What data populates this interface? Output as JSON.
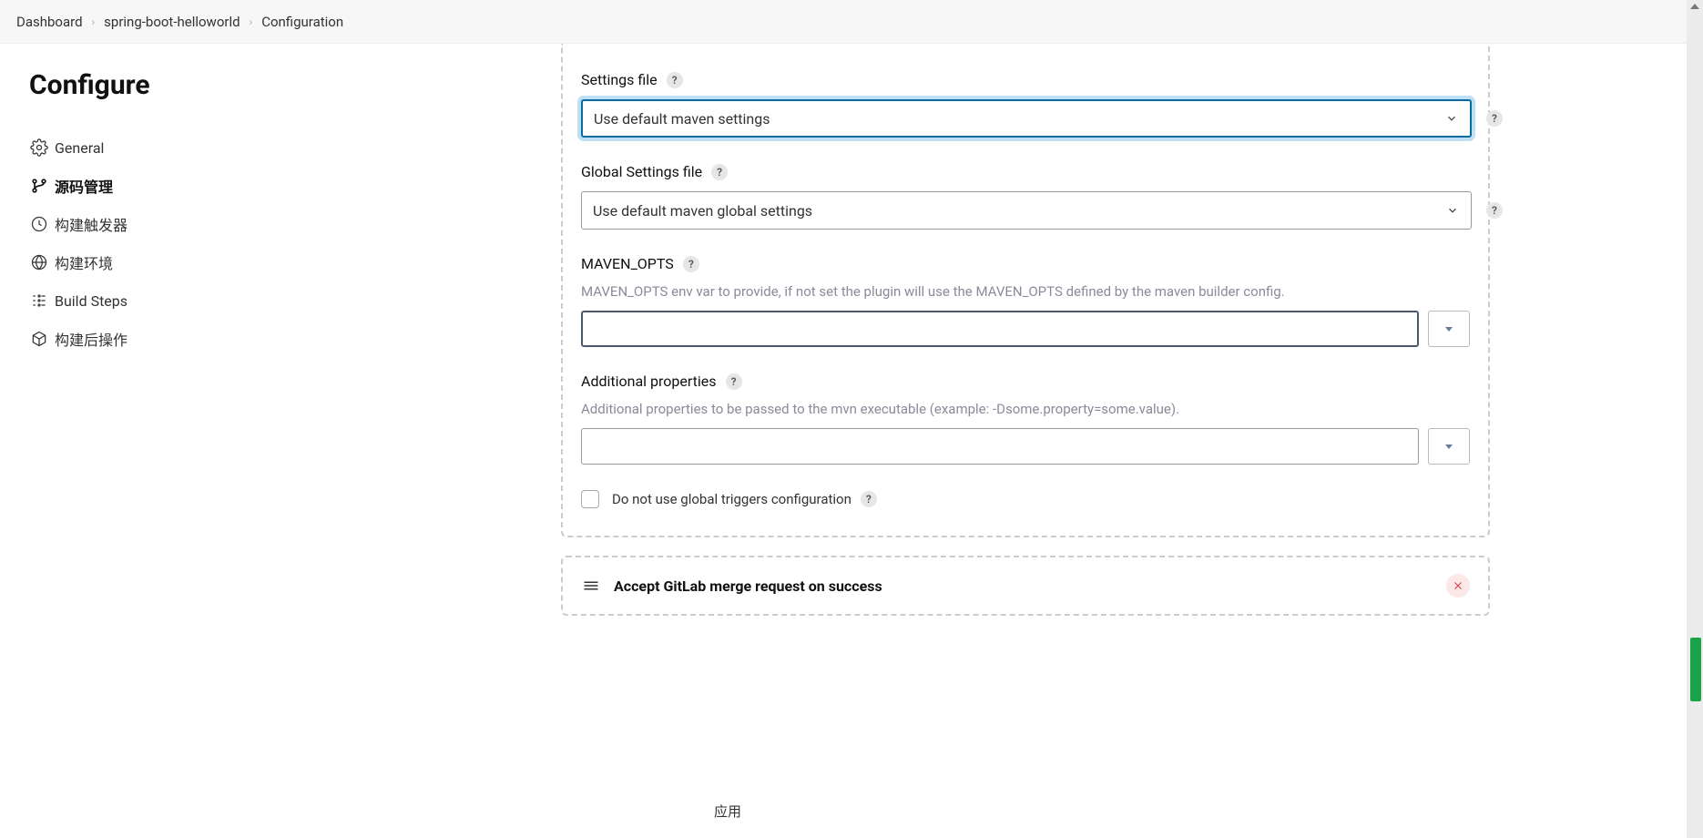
{
  "breadcrumb": {
    "dashboard": "Dashboard",
    "project": "spring-boot-helloworld",
    "page": "Configuration"
  },
  "sidebar": {
    "title": "Configure",
    "items": [
      {
        "label": "General"
      },
      {
        "label": "源码管理"
      },
      {
        "label": "构建触发器"
      },
      {
        "label": "构建环境"
      },
      {
        "label": "Build Steps"
      },
      {
        "label": "构建后操作"
      }
    ]
  },
  "form": {
    "settingsFile": {
      "label": "Settings file",
      "value": "Use default maven settings"
    },
    "globalSettingsFile": {
      "label": "Global Settings file",
      "value": "Use default maven global settings"
    },
    "mavenOpts": {
      "label": "MAVEN_OPTS",
      "desc": "MAVEN_OPTS env var to provide, if not set the plugin will use the MAVEN_OPTS defined by the maven builder config.",
      "value": ""
    },
    "additionalProps": {
      "label": "Additional properties",
      "desc": "Additional properties to be passed to the mvn executable (example: -Dsome.property=some.value).",
      "value": ""
    },
    "noGlobalTriggers": {
      "label": "Do not use global triggers configuration",
      "checked": false
    },
    "section2": {
      "title": "Accept GitLab merge request on success"
    }
  },
  "footer": {
    "save": "",
    "apply": "应用"
  }
}
